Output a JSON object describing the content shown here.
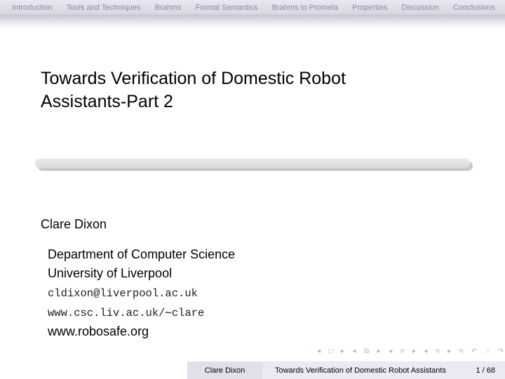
{
  "nav": {
    "sections": [
      "Introduction",
      "Tools and Techniques",
      "Brahms",
      "Formal Semantics",
      "Brahms to Promela",
      "Properties",
      "Discussion",
      "Conclusions"
    ]
  },
  "slide": {
    "title_line1": "Towards Verification of Domestic Robot",
    "title_line2": "Assistants-Part 2",
    "author": "Clare Dixon",
    "department": "Department of Computer Science",
    "university": "University of Liverpool",
    "email": "cldixon@liverpool.ac.uk",
    "homepage": "www.csc.liv.ac.uk/∼clare",
    "project_site": "www.robosafe.org"
  },
  "footer": {
    "author": "Clare Dixon",
    "title": "Towards Verification of Domestic Robot Assistants",
    "page": "1 / 68"
  },
  "colors": {
    "headline_bg": "#dcdce6",
    "nav_text": "#8a8aa0",
    "footer_author_bg": "#e0e0ea",
    "footer_title_bg": "#eaeaf2"
  }
}
